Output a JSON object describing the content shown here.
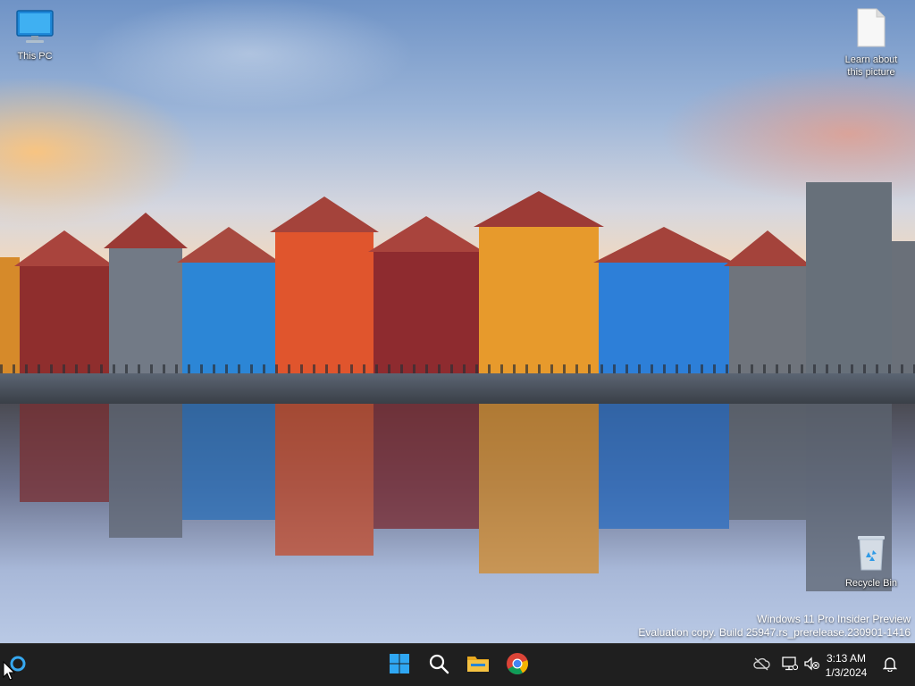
{
  "desktop": {
    "icons": [
      {
        "label": "This PC",
        "icon": "monitor-icon"
      },
      {
        "label": "Learn about this picture",
        "icon": "document-icon"
      },
      {
        "label": "Recycle Bin",
        "icon": "recycle-bin-icon"
      }
    ],
    "watermark": {
      "line1": "Windows 11 Pro Insider Preview",
      "line2": "Evaluation copy. Build 25947.rs_prerelease.230901-1416"
    }
  },
  "taskbar": {
    "apps": [
      {
        "name": "Start",
        "icon": "windows-start-icon"
      },
      {
        "name": "Search",
        "icon": "search-icon"
      },
      {
        "name": "File Explorer",
        "icon": "folder-icon"
      },
      {
        "name": "Google Chrome",
        "icon": "chrome-icon"
      }
    ],
    "widgets_icon": "copilot-icon",
    "tray": {
      "icons": [
        "cloud-offline-icon",
        "network-icon",
        "volume-muted-icon",
        "notification-bell-icon"
      ],
      "time": "3:13 AM",
      "date": "1/3/2024"
    }
  },
  "colors": {
    "taskbar_bg": "#1f1f1f",
    "start_blue": "#2fa7f3",
    "folder_yellow": "#f5c242"
  }
}
